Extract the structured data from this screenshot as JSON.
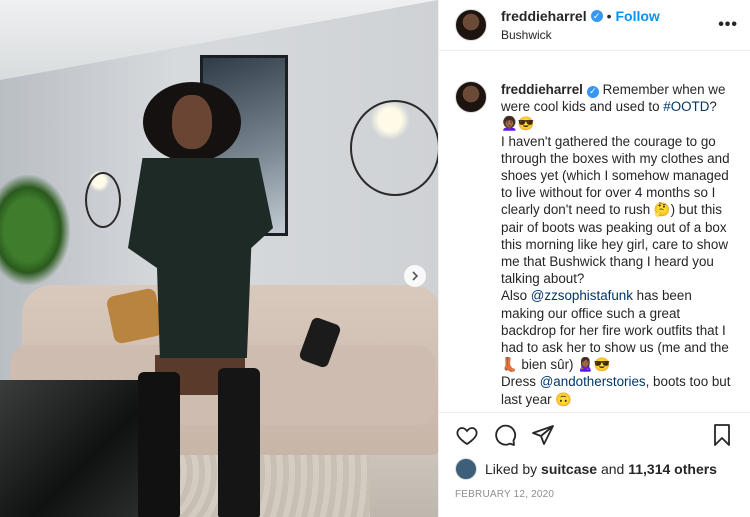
{
  "header": {
    "username": "freddieharrel",
    "separator": "•",
    "follow_label": "Follow",
    "location": "Bushwick",
    "more_label": "•••"
  },
  "caption": {
    "username": "freddieharrel",
    "parts": [
      {
        "t": "text",
        "v": " Remember when we were cool kids and used to "
      },
      {
        "t": "link",
        "v": "#OOTD"
      },
      {
        "t": "text",
        "v": "?\n👩🏾‍🦱😎\nI haven't gathered the courage to go through the boxes with my clothes and shoes yet (which I somehow managed to live without for over 4 months so I clearly don't need to rush 🤔) but this pair of boots was peaking out of a box this morning like hey girl, care to show me that Bushwick thang I heard you talking about?\nAlso "
      },
      {
        "t": "link",
        "v": "@zzsophistafunk"
      },
      {
        "t": "text",
        "v": " has been making our office such a great backdrop for her fire work outfits that I had to ask her to show us (me and the 👢 bien sûr) 🙎🏾‍♀️😎\nDress "
      },
      {
        "t": "link",
        "v": "@andotherstories"
      },
      {
        "t": "text",
        "v": ", boots too but last year 🙃"
      }
    ]
  },
  "likes": {
    "prefix": "Liked by ",
    "user": "suitcase",
    "middle": " and ",
    "count": "11,314 others"
  },
  "date": "FEBRUARY 12, 2020",
  "icons": {
    "like": "heart-icon",
    "comment": "comment-icon",
    "share": "share-icon",
    "save": "bookmark-icon",
    "verified": "verified-badge-icon",
    "next": "chevron-right-icon"
  },
  "colors": {
    "link": "#00376b",
    "follow": "#0095f6",
    "verified": "#3897f0",
    "date": "#8e8e8e"
  }
}
